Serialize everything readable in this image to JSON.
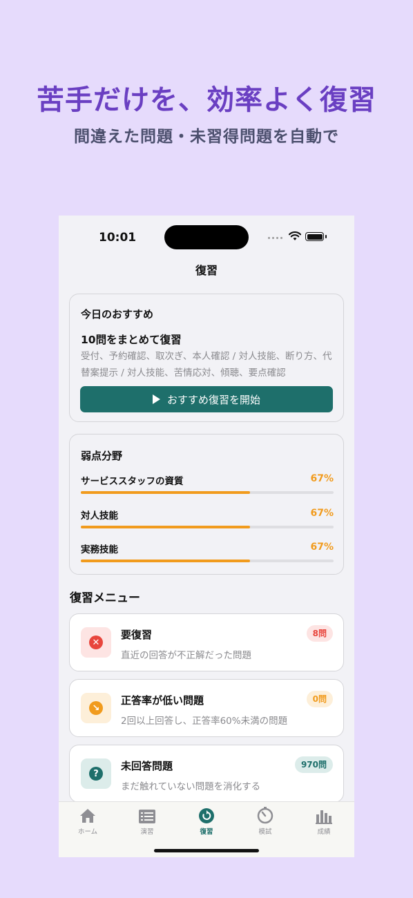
{
  "promo": {
    "headline": "苦手だけを、効率よく復習",
    "subhead": "間違えた問題・未習得問題を自動で"
  },
  "status_bar": {
    "time": "10:01"
  },
  "nav": {
    "title": "復習"
  },
  "recommendation": {
    "title": "今日のおすすめ",
    "heading": "10問をまとめて復習",
    "description": "受付、予約確認、取次ぎ、本人確認 / 対人技能、断り方、代替案提示 / 対人技能、苦情応対、傾聴、要点確認",
    "button_label": "おすすめ復習を開始"
  },
  "weak_areas": {
    "title": "弱点分野",
    "items": [
      {
        "label": "サービススタッフの資質",
        "percent": "67%",
        "value": 0.67
      },
      {
        "label": "対人技能",
        "percent": "67%",
        "value": 0.67
      },
      {
        "label": "実務技能",
        "percent": "67%",
        "value": 0.67
      }
    ]
  },
  "review_menu": {
    "title": "復習メニュー",
    "items": [
      {
        "title": "要復習",
        "description": "直近の回答が不正解だった問題",
        "badge": "8問",
        "icon": "x-circle-icon",
        "icon_glyph": "✕",
        "icon_color": "#e8453c",
        "icon_bg": "#fde4e3",
        "badge_bg": "#fde4e3",
        "badge_color": "#e8453c"
      },
      {
        "title": "正答率が低い問題",
        "description": "2回以上回答し、正答率60%未満の問題",
        "badge": "0問",
        "icon": "chart-down-icon",
        "icon_glyph": "↘",
        "icon_color": "#f19b1d",
        "icon_bg": "#fdefd9",
        "badge_bg": "#fdefd9",
        "badge_color": "#f19b1d"
      },
      {
        "title": "未回答問題",
        "description": "まだ触れていない問題を消化する",
        "badge": "970問",
        "icon": "question-circle-icon",
        "icon_glyph": "?",
        "icon_color": "#1e6f6b",
        "icon_bg": "#dcecea",
        "badge_bg": "#dcecea",
        "badge_color": "#1e6f6b"
      }
    ]
  },
  "tabs": [
    {
      "label": "ホーム",
      "icon": "home-icon"
    },
    {
      "label": "演習",
      "icon": "list-icon"
    },
    {
      "label": "復習",
      "icon": "review-icon",
      "active": true
    },
    {
      "label": "模試",
      "icon": "timer-icon"
    },
    {
      "label": "成績",
      "icon": "bar-chart-icon"
    }
  ],
  "colors": {
    "accent": "#1e6f6b",
    "warning": "#f19b1d",
    "promo_background": "#e6dbfc",
    "headline": "#6a3fc2"
  }
}
